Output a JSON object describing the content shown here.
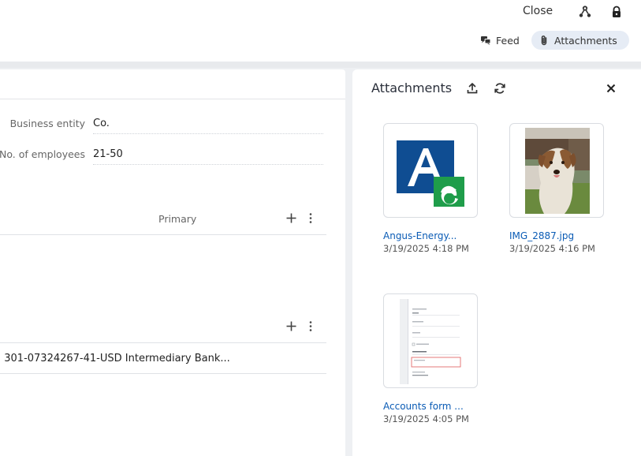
{
  "header": {
    "close_label": "Close",
    "icons": [
      "hierarchy-icon",
      "lock-icon"
    ]
  },
  "tabs": [
    {
      "label": "Feed",
      "icon": "feed-icon",
      "active": false
    },
    {
      "label": "Attachments",
      "icon": "paperclip-icon",
      "active": true
    }
  ],
  "form": {
    "fields": [
      {
        "label": "Business entity",
        "value": "Co."
      },
      {
        "label": "No. of employees",
        "value": "21-50"
      }
    ],
    "contacts_section": {
      "column_header": "Primary"
    },
    "bank_section": {
      "row_text": ". 301-07324267-41-USD Intermediary Bank..."
    }
  },
  "attachments_panel": {
    "title": "Attachments",
    "items": [
      {
        "name": "Angus-Energy...",
        "date": "3/19/2025 4:18 PM",
        "thumb": "logo"
      },
      {
        "name": "IMG_2887.jpg",
        "date": "3/19/2025 4:16 PM",
        "thumb": "photo"
      },
      {
        "name": "Accounts form ...",
        "date": "3/19/2025 4:05 PM",
        "thumb": "document"
      }
    ]
  },
  "colors": {
    "link": "#0a5bb5",
    "active_tab_bg": "#e6ecf5",
    "logo_blue": "#0f4d92",
    "logo_green": "#1f9d4a",
    "page_bg": "#eef0f3"
  }
}
